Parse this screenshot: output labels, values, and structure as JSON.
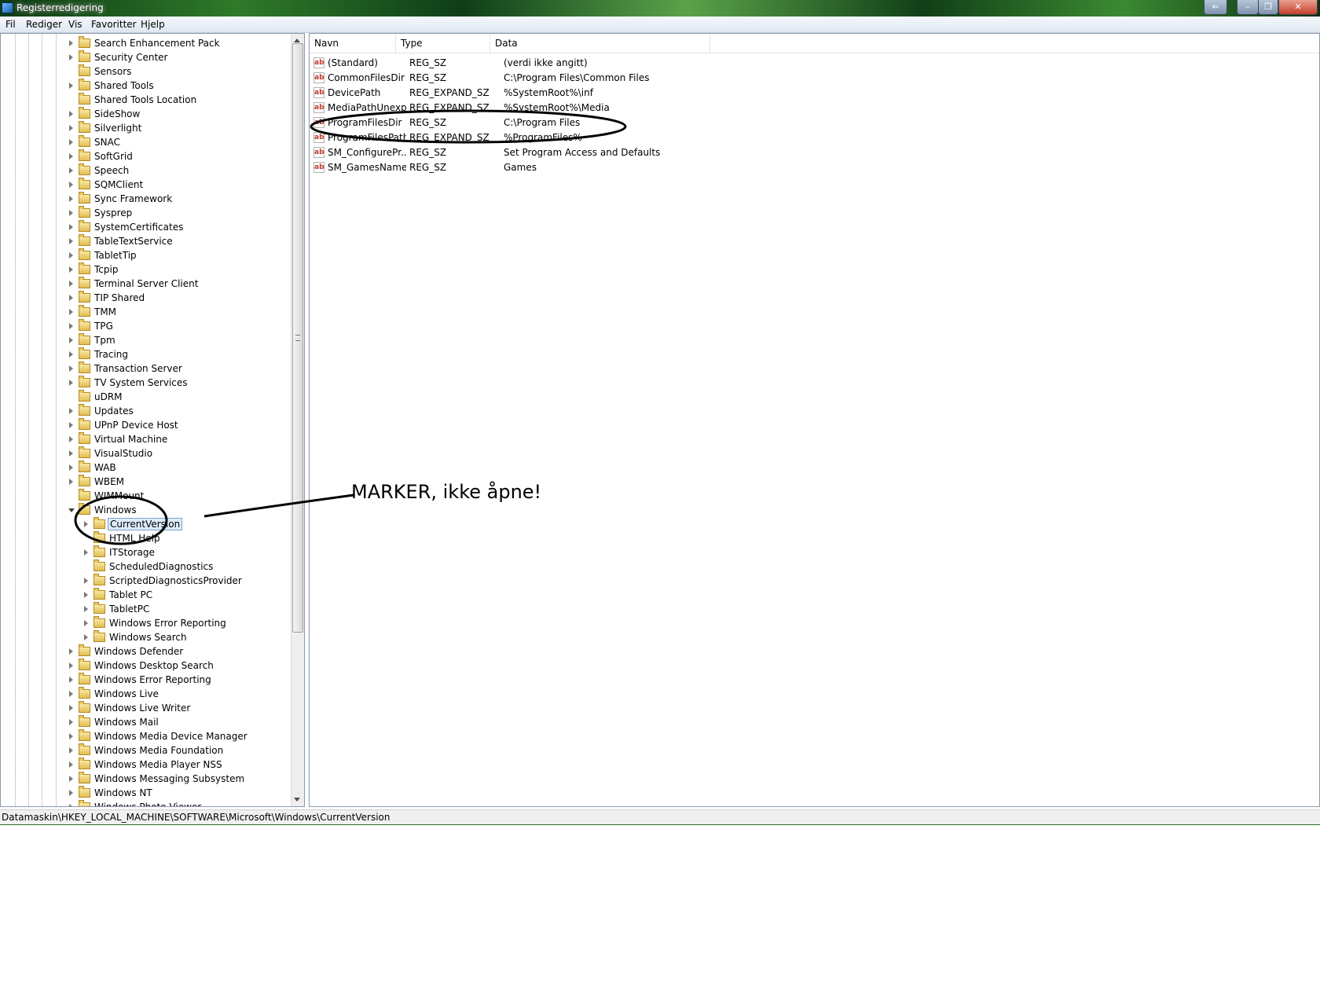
{
  "window": {
    "title": "Registerredigering"
  },
  "menu": [
    "Fil",
    "Rediger",
    "Vis",
    "Favoritter",
    "Hjelp"
  ],
  "tree": {
    "items": [
      {
        "label": "Search Enhancement Pack",
        "level": 1,
        "expander": true
      },
      {
        "label": "Security Center",
        "level": 1,
        "expander": true
      },
      {
        "label": "Sensors",
        "level": 1,
        "expander": false
      },
      {
        "label": "Shared Tools",
        "level": 1,
        "expander": true
      },
      {
        "label": "Shared Tools Location",
        "level": 1,
        "expander": false
      },
      {
        "label": "SideShow",
        "level": 1,
        "expander": true
      },
      {
        "label": "Silverlight",
        "level": 1,
        "expander": true
      },
      {
        "label": "SNAC",
        "level": 1,
        "expander": true
      },
      {
        "label": "SoftGrid",
        "level": 1,
        "expander": true
      },
      {
        "label": "Speech",
        "level": 1,
        "expander": true
      },
      {
        "label": "SQMClient",
        "level": 1,
        "expander": true
      },
      {
        "label": "Sync Framework",
        "level": 1,
        "expander": true
      },
      {
        "label": "Sysprep",
        "level": 1,
        "expander": true
      },
      {
        "label": "SystemCertificates",
        "level": 1,
        "expander": true
      },
      {
        "label": "TableTextService",
        "level": 1,
        "expander": true
      },
      {
        "label": "TabletTip",
        "level": 1,
        "expander": true
      },
      {
        "label": "Tcpip",
        "level": 1,
        "expander": true
      },
      {
        "label": "Terminal Server Client",
        "level": 1,
        "expander": true
      },
      {
        "label": "TIP Shared",
        "level": 1,
        "expander": true
      },
      {
        "label": "TMM",
        "level": 1,
        "expander": true
      },
      {
        "label": "TPG",
        "level": 1,
        "expander": true
      },
      {
        "label": "Tpm",
        "level": 1,
        "expander": true
      },
      {
        "label": "Tracing",
        "level": 1,
        "expander": true
      },
      {
        "label": "Transaction Server",
        "level": 1,
        "expander": true
      },
      {
        "label": "TV System Services",
        "level": 1,
        "expander": true
      },
      {
        "label": "uDRM",
        "level": 1,
        "expander": false
      },
      {
        "label": "Updates",
        "level": 1,
        "expander": true
      },
      {
        "label": "UPnP Device Host",
        "level": 1,
        "expander": true
      },
      {
        "label": "Virtual Machine",
        "level": 1,
        "expander": true
      },
      {
        "label": "VisualStudio",
        "level": 1,
        "expander": true
      },
      {
        "label": "WAB",
        "level": 1,
        "expander": true
      },
      {
        "label": "WBEM",
        "level": 1,
        "expander": true
      },
      {
        "label": "WIMMount",
        "level": 1,
        "expander": false
      },
      {
        "label": "Windows",
        "level": 1,
        "expander": "open"
      },
      {
        "label": "CurrentVersion",
        "level": 2,
        "expander": true,
        "selected": true
      },
      {
        "label": "HTML Help",
        "level": 2,
        "expander": false
      },
      {
        "label": "ITStorage",
        "level": 2,
        "expander": true
      },
      {
        "label": "ScheduledDiagnostics",
        "level": 2,
        "expander": false
      },
      {
        "label": "ScriptedDiagnosticsProvider",
        "level": 2,
        "expander": true
      },
      {
        "label": "Tablet PC",
        "level": 2,
        "expander": true
      },
      {
        "label": "TabletPC",
        "level": 2,
        "expander": true
      },
      {
        "label": "Windows Error Reporting",
        "level": 2,
        "expander": true
      },
      {
        "label": "Windows Search",
        "level": 2,
        "expander": true
      },
      {
        "label": "Windows Defender",
        "level": 1,
        "expander": true
      },
      {
        "label": "Windows Desktop Search",
        "level": 1,
        "expander": true
      },
      {
        "label": "Windows Error Reporting",
        "level": 1,
        "expander": true
      },
      {
        "label": "Windows Live",
        "level": 1,
        "expander": true
      },
      {
        "label": "Windows Live Writer",
        "level": 1,
        "expander": true
      },
      {
        "label": "Windows Mail",
        "level": 1,
        "expander": true
      },
      {
        "label": "Windows Media Device Manager",
        "level": 1,
        "expander": true
      },
      {
        "label": "Windows Media Foundation",
        "level": 1,
        "expander": true
      },
      {
        "label": "Windows Media Player NSS",
        "level": 1,
        "expander": true
      },
      {
        "label": "Windows Messaging Subsystem",
        "level": 1,
        "expander": true
      },
      {
        "label": "Windows NT",
        "level": 1,
        "expander": true
      },
      {
        "label": "Windows Photo Viewer",
        "level": 1,
        "expander": true
      }
    ]
  },
  "list": {
    "columns": [
      "Navn",
      "Type",
      "Data"
    ],
    "rows": [
      {
        "name": "(Standard)",
        "type": "REG_SZ",
        "data": "(verdi ikke angitt)"
      },
      {
        "name": "CommonFilesDir",
        "type": "REG_SZ",
        "data": "C:\\Program Files\\Common Files"
      },
      {
        "name": "DevicePath",
        "type": "REG_EXPAND_SZ",
        "data": "%SystemRoot%\\inf"
      },
      {
        "name": "MediaPathUnexpanded",
        "type": "REG_EXPAND_SZ",
        "data": "%SystemRoot%\\Media"
      },
      {
        "name": "ProgramFilesDir",
        "type": "REG_SZ",
        "data": "C:\\Program Files"
      },
      {
        "name": "ProgramFilesPath",
        "type": "REG_EXPAND_SZ",
        "data": "%ProgramFiles%"
      },
      {
        "name": "SM_ConfigurePr...",
        "type": "REG_SZ",
        "data": "Set Program Access and Defaults"
      },
      {
        "name": "SM_GamesName",
        "type": "REG_SZ",
        "data": "Games"
      }
    ]
  },
  "status": {
    "path": "Datamaskin\\HKEY_LOCAL_MACHINE\\SOFTWARE\\Microsoft\\Windows\\CurrentVersion"
  },
  "annotation": {
    "text": "MARKER, ikke åpne!"
  },
  "icons": {
    "app": "registry-editor-icon",
    "value": "string-value-icon",
    "folder": "folder-icon"
  }
}
